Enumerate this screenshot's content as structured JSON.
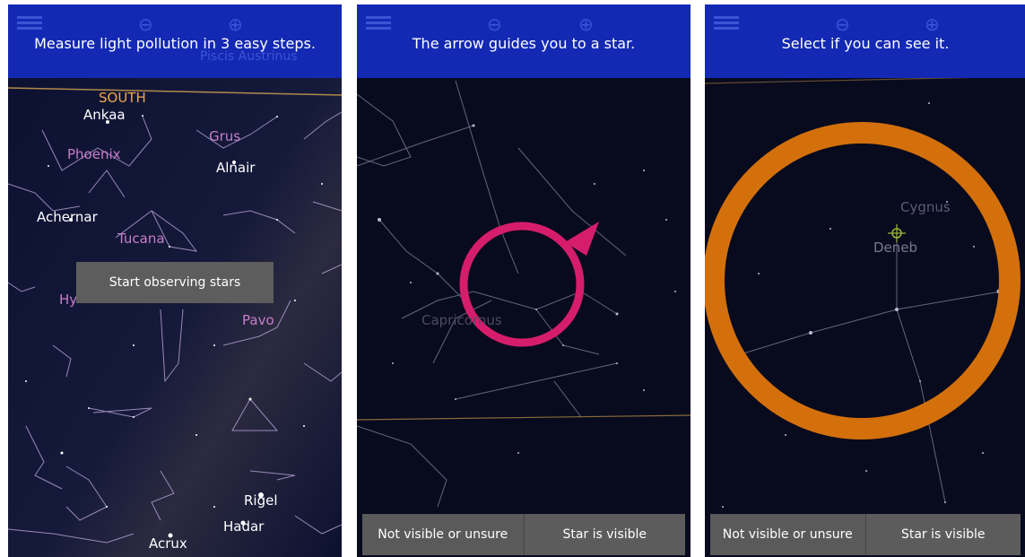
{
  "colors": {
    "banner": "#1329b4",
    "sky": "#080a1e",
    "pink_guide": "#d61d6b",
    "orange_ring": "#d3700c",
    "constellation_label": "#c77ec9",
    "direction_label": "#f0a84a",
    "button_gray": "#5a5a5a"
  },
  "screen1": {
    "banner_text": "Measure light pollution in 3 easy steps.",
    "ghost_label": "Piscis Austrinus",
    "direction": "SOUTH",
    "stars": [
      "Ankaa",
      "Alnair",
      "Achernar",
      "Rigel",
      "Hadar",
      "Acrux"
    ],
    "constellations": [
      "Phoenix",
      "Grus",
      "Tucana",
      "Hy",
      "Pavo"
    ],
    "start_button": "Start observing stars"
  },
  "screen2": {
    "banner_text": "The arrow guides you to a star.",
    "constellation": "Capricornus",
    "not_visible_button": "Not visible or unsure",
    "visible_button": "Star is visible"
  },
  "screen3": {
    "banner_text": "Select if you can see it.",
    "constellation": "Cygnus",
    "star": "Deneb",
    "not_visible_button": "Not visible or unsure",
    "visible_button": "Star is visible"
  }
}
